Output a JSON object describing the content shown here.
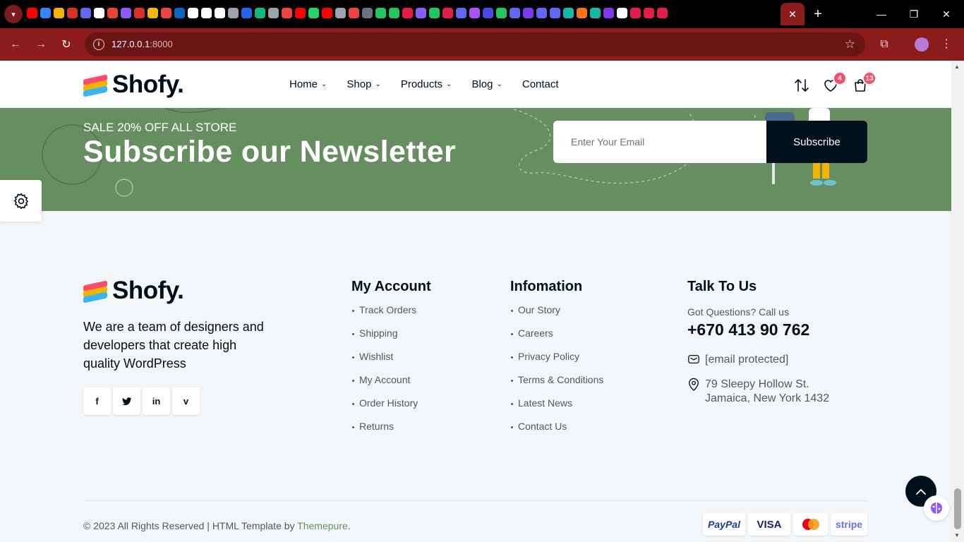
{
  "browser": {
    "favicon_colors": [
      "#ff0000",
      "#3b82f6",
      "#f5b400",
      "#d93025",
      "#6366f1",
      "#ffffff",
      "#ea4335",
      "#8b5cf6",
      "#d93025",
      "#f0b90b",
      "#ef4444",
      "#0a66c2",
      "#ffffff",
      "#ffffff",
      "#ffffff",
      "#9ca3af",
      "#2563eb",
      "#10b981",
      "#9ca3af",
      "#ef4444",
      "#ff0000",
      "#25d366",
      "#ff0000",
      "#9ca3af",
      "#ef4444",
      "#6b7280",
      "#22c55e",
      "#22c55e",
      "#e11d48",
      "#8b5cf6",
      "#22c55e",
      "#e11d48",
      "#6366f1",
      "#a855f7",
      "#4f46e5",
      "#22c55e",
      "#6366f1",
      "#7c3aed",
      "#6366f1",
      "#6366f1",
      "#14b8a6",
      "#f97316",
      "#14b8a6",
      "#7c3aed",
      "#ffffff",
      "#e11d48",
      "#e11d48",
      "#e11d48"
    ],
    "active_tab_close": "✕",
    "new_tab": "+",
    "url_host": "127.0.0.1",
    "url_port": ":8000",
    "icons": {
      "back": "back-arrow-icon",
      "forward": "forward-arrow-icon",
      "reload": "reload-icon",
      "info": "site-info-icon",
      "bookmark": "star-icon",
      "extensions": "puzzle-icon",
      "menu": "kebab-menu-icon"
    }
  },
  "header": {
    "logo_text": "Shofy.",
    "nav": [
      {
        "label": "Home",
        "dropdown": true
      },
      {
        "label": "Shop",
        "dropdown": true
      },
      {
        "label": "Products",
        "dropdown": true
      },
      {
        "label": "Blog",
        "dropdown": true
      },
      {
        "label": "Contact",
        "dropdown": false
      }
    ],
    "wishlist_count": "4",
    "cart_count": "13"
  },
  "newsletter": {
    "subtitle": "SALE 20% OFF ALL STORE",
    "title": "Subscribe our Newsletter",
    "email_placeholder": "Enter Your Email",
    "button_label": "Subscribe"
  },
  "footer": {
    "logo_text": "Shofy.",
    "about": "We are a team of designers and developers that create high quality WordPress",
    "socials": [
      "facebook-icon",
      "twitter-icon",
      "linkedin-icon",
      "vimeo-icon"
    ],
    "my_account": {
      "title": "My Account",
      "links": [
        "Track Orders",
        "Shipping",
        "Wishlist",
        "My Account",
        "Order History",
        "Returns"
      ]
    },
    "information": {
      "title": "Infomation",
      "links": [
        "Our Story",
        "Careers",
        "Privacy Policy",
        "Terms & Conditions",
        "Latest News",
        "Contact Us"
      ]
    },
    "talk": {
      "title": "Talk To Us",
      "question": "Got Questions? Call us",
      "phone": "+670 413 90 762",
      "email": "[email protected]",
      "address_line1": "79 Sleepy Hollow St.",
      "address_line2": "Jamaica, New York 1432"
    },
    "copyright_prefix": "© 2023 All Rights Reserved | HTML Template by",
    "copyright_link": "Themepure",
    "copyright_suffix": ".",
    "payments": [
      "PayPal",
      "VISA",
      "mastercard",
      "stripe"
    ]
  },
  "colors": {
    "accent_green": "#678e61",
    "dark": "#010f1c",
    "badge_pink": "#fd4b6b",
    "browser_red": "#8c1b1b"
  }
}
